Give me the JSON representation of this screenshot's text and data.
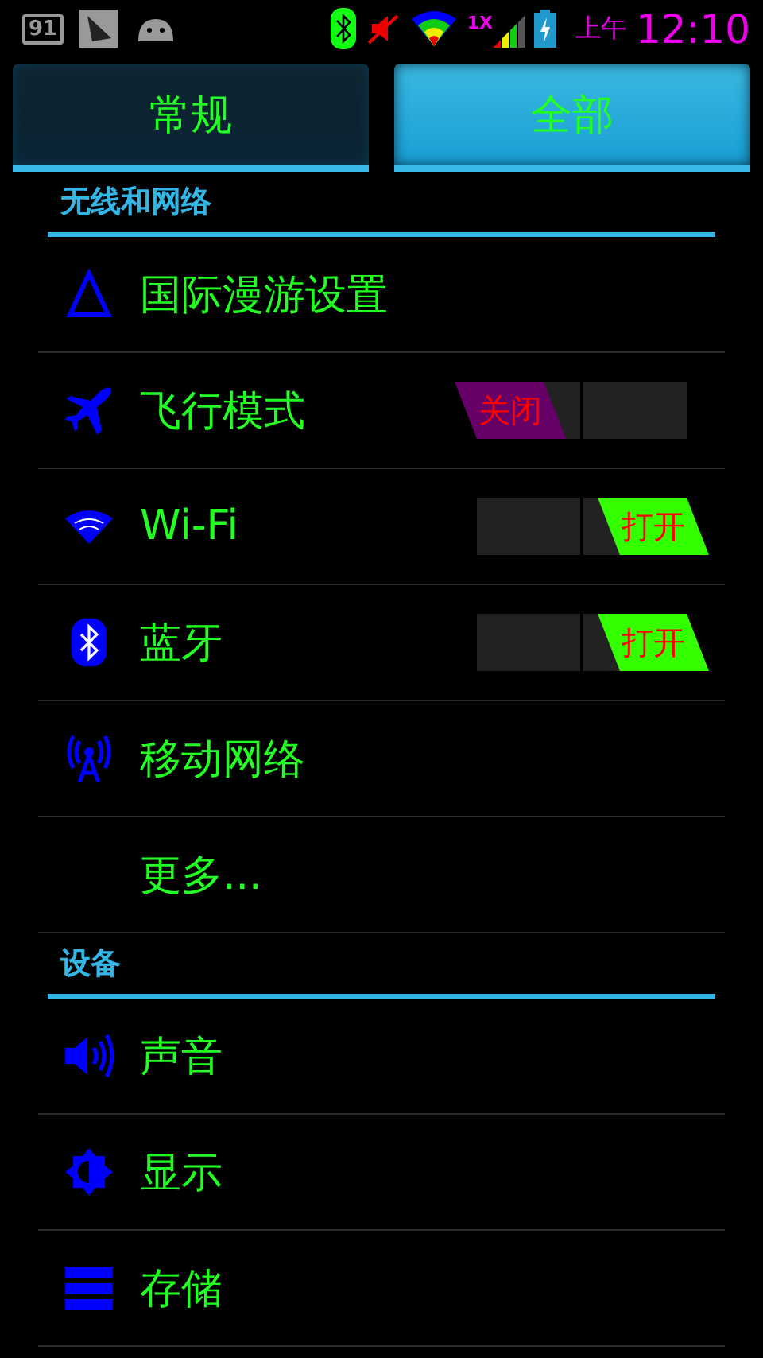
{
  "status_bar": {
    "battery_badge": "91",
    "network_type": "1X",
    "am_pm": "上午",
    "time": "12:10"
  },
  "tabs": [
    {
      "label": "常规",
      "selected": false
    },
    {
      "label": "全部",
      "selected": true
    }
  ],
  "sections": [
    {
      "title": "无线和网络",
      "items": [
        {
          "kind": "link",
          "label": "国际漫游设置"
        },
        {
          "kind": "switch",
          "label": "飞行模式",
          "on": false,
          "switch_label": "关闭"
        },
        {
          "kind": "switch",
          "label": "Wi-Fi",
          "on": true,
          "switch_label": "打开"
        },
        {
          "kind": "switch",
          "label": "蓝牙",
          "on": true,
          "switch_label": "打开"
        },
        {
          "kind": "link",
          "label": "移动网络"
        },
        {
          "kind": "link",
          "label": "更多..."
        }
      ]
    },
    {
      "title": "设备",
      "items": [
        {
          "kind": "link",
          "label": "声音"
        },
        {
          "kind": "link",
          "label": "显示"
        },
        {
          "kind": "link",
          "label": "存储"
        }
      ]
    }
  ]
}
